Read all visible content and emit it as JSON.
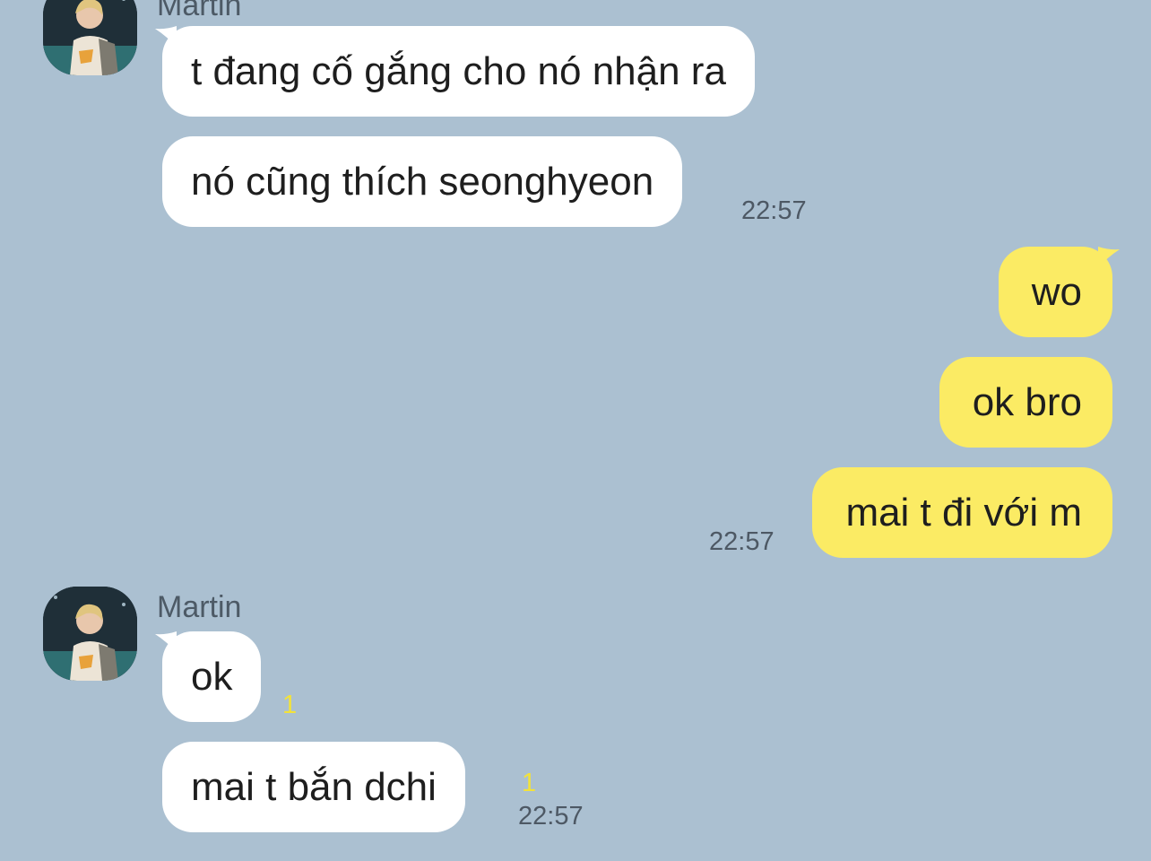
{
  "colors": {
    "background": "#abc0d1",
    "incoming_bubble": "#ffffff",
    "outgoing_bubble": "#fbeb64",
    "unread_count": "#f3e23a",
    "timestamp": "#4d5864"
  },
  "groups": [
    {
      "sender": "Martin",
      "avatar_icon": "profile-photo",
      "messages": [
        {
          "text": "t đang cố gắng cho nó nhận ra"
        },
        {
          "text": "nó cũng thích seonghyeon",
          "time": "22:57"
        }
      ]
    },
    {
      "sender": "",
      "messages": [
        {
          "text": "wo"
        },
        {
          "text": "ok bro"
        },
        {
          "text": "mai t đi với m",
          "time": "22:57"
        }
      ]
    },
    {
      "sender": "Martin",
      "avatar_icon": "profile-photo",
      "messages": [
        {
          "text": "ok",
          "unread": "1"
        },
        {
          "text": "mai t bắn dchi",
          "unread": "1",
          "time": "22:57"
        }
      ]
    }
  ]
}
